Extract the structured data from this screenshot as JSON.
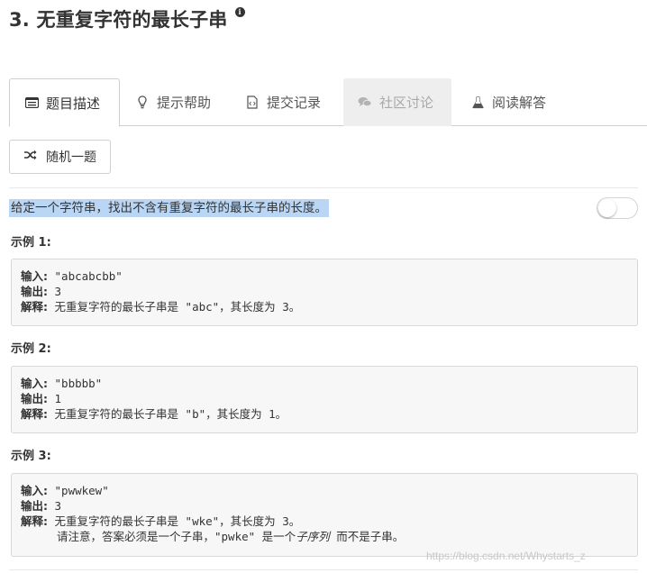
{
  "problem": {
    "title": "3. 无重复字符的最长子串",
    "info_icon": "info-circle-icon"
  },
  "tabs": [
    {
      "label": "题目描述",
      "icon": "list-icon",
      "active": true
    },
    {
      "label": "提示帮助",
      "icon": "lightbulb-icon",
      "active": false
    },
    {
      "label": "提交记录",
      "icon": "code-file-icon",
      "active": false
    },
    {
      "label": "社区讨论",
      "icon": "comments-icon",
      "active": false,
      "disabled": true
    },
    {
      "label": "阅读解答",
      "icon": "flask-icon",
      "active": false
    }
  ],
  "random_button": {
    "label": "随机一题",
    "icon": "shuffle-icon"
  },
  "description": "给定一个字符串，找出不含有重复字符的最长子串的长度。",
  "toggle": {
    "on": false
  },
  "examples": [
    {
      "label": "示例 1:",
      "input_key": "输入:",
      "input_value": " \"abcabcbb\"",
      "output_key": "输出:",
      "output_value": " 3",
      "explain_key": "解释:",
      "explain_value": " 无重复字符的最长子串是 \"abc\"，其长度为 3。"
    },
    {
      "label": "示例 2:",
      "input_key": "输入:",
      "input_value": " \"bbbbb\"",
      "output_key": "输出:",
      "output_value": " 1",
      "explain_key": "解释:",
      "explain_value": " 无重复字符的最长子串是 \"b\"，其长度为 1。"
    },
    {
      "label": "示例 3:",
      "input_key": "输入:",
      "input_value": " \"pwwkew\"",
      "output_key": "输出:",
      "output_value": " 3",
      "explain_key": "解释:",
      "explain_value": " 无重复字符的最长子串是 \"wke\"，其长度为 3。",
      "note_prefix": "请注意，答案必须是一个子串，\"pwke\" 是一个",
      "note_emph": "子序列",
      "note_suffix": " 而不是子串。"
    }
  ],
  "watermark": "https://blog.csdn.net/Whystarts_z"
}
